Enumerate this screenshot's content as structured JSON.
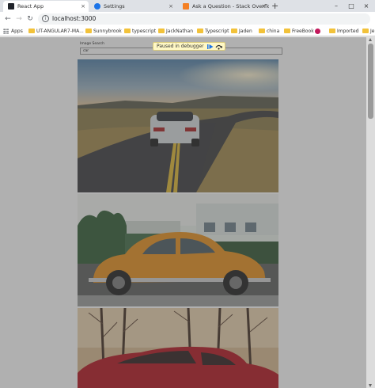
{
  "tabs": [
    {
      "title": "React App",
      "favicon_color": "#20232a",
      "active": true
    },
    {
      "title": "Settings",
      "favicon_color": "#1a73e8",
      "active": false
    },
    {
      "title": "Ask a Question - Stack Overflow",
      "favicon_color": "#f48024",
      "active": false
    }
  ],
  "tab_close_glyph": "×",
  "new_tab_glyph": "+",
  "window_controls": {
    "minimize": "–",
    "maximize": "□",
    "close": "×"
  },
  "toolbar": {
    "back_glyph": "←",
    "forward_glyph": "→",
    "reload_glyph": "↻",
    "info_glyph": "i",
    "url": "localhost:3000"
  },
  "bookmarks": [
    {
      "label": "Apps",
      "icon": "apps-grid-icon"
    },
    {
      "label": "UT-ANGULAR7-MA...",
      "icon": "folder-icon"
    },
    {
      "label": "Sunnybrook",
      "icon": "folder-icon"
    },
    {
      "label": "typescript",
      "icon": "folder-icon"
    },
    {
      "label": "JackNathan",
      "icon": "folder-icon"
    },
    {
      "label": "Typescript",
      "icon": "folder-icon"
    },
    {
      "label": "Jaden",
      "icon": "folder-icon"
    },
    {
      "label": "china",
      "icon": "folder-icon"
    },
    {
      "label": "FreeBook",
      "icon": "folder-icon"
    },
    {
      "label": "",
      "icon": "site-icon"
    },
    {
      "label": "Imported",
      "icon": "folder-icon"
    },
    {
      "label": "Je",
      "icon": "folder-icon"
    }
  ],
  "search": {
    "label": "Image Search",
    "value": "car"
  },
  "debugger": {
    "text": "Paused in debugger",
    "accent": "#1a73e8"
  },
  "images": [
    {
      "alt": "white sports car on winding road at sunset"
    },
    {
      "alt": "orange vintage beetle parked in front of building"
    },
    {
      "alt": "red car in front of bare trees"
    }
  ]
}
